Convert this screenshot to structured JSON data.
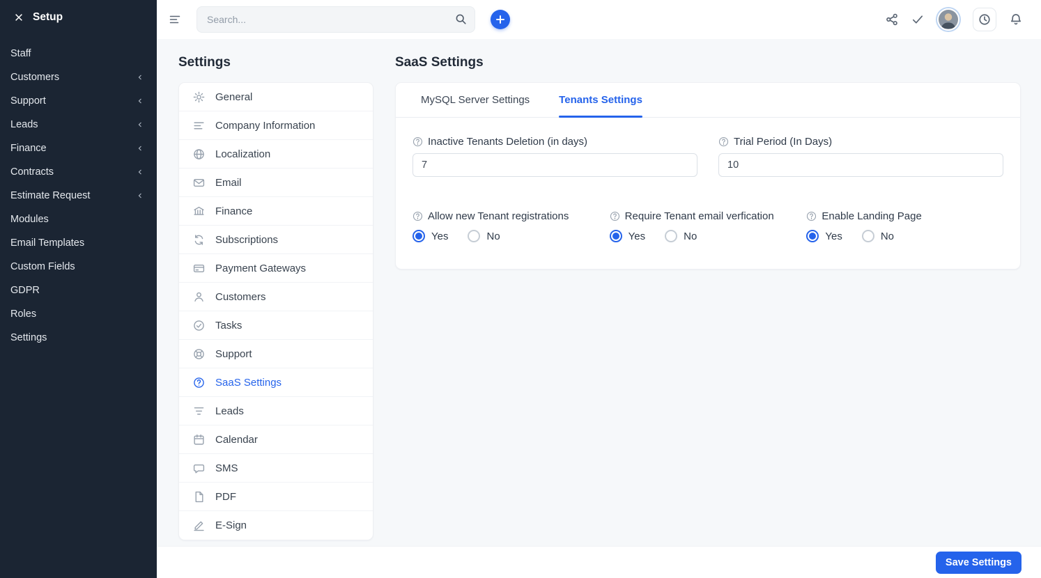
{
  "colors": {
    "accent": "#2563eb",
    "sidebar_bg": "#1b2533"
  },
  "sidebar": {
    "title": "Setup",
    "items": [
      {
        "label": "Staff",
        "expandable": false
      },
      {
        "label": "Customers",
        "expandable": true
      },
      {
        "label": "Support",
        "expandable": true
      },
      {
        "label": "Leads",
        "expandable": true
      },
      {
        "label": "Finance",
        "expandable": true
      },
      {
        "label": "Contracts",
        "expandable": true
      },
      {
        "label": "Estimate Request",
        "expandable": true
      },
      {
        "label": "Modules",
        "expandable": false
      },
      {
        "label": "Email Templates",
        "expandable": false
      },
      {
        "label": "Custom Fields",
        "expandable": false
      },
      {
        "label": "GDPR",
        "expandable": false
      },
      {
        "label": "Roles",
        "expandable": false
      },
      {
        "label": "Settings",
        "expandable": false
      }
    ]
  },
  "topbar": {
    "search_placeholder": "Search...",
    "icons": [
      "menu-toggle-icon",
      "search-icon",
      "add-icon",
      "share-icon",
      "check-icon",
      "avatar",
      "clock-icon",
      "bell-icon"
    ]
  },
  "settings_menu": {
    "title": "Settings",
    "items": [
      {
        "label": "General",
        "icon": "gear-icon"
      },
      {
        "label": "Company Information",
        "icon": "align-left-icon"
      },
      {
        "label": "Localization",
        "icon": "globe-icon"
      },
      {
        "label": "Email",
        "icon": "envelope-icon"
      },
      {
        "label": "Finance",
        "icon": "bank-icon"
      },
      {
        "label": "Subscriptions",
        "icon": "refresh-icon"
      },
      {
        "label": "Payment Gateways",
        "icon": "credit-card-icon"
      },
      {
        "label": "Customers",
        "icon": "user-icon"
      },
      {
        "label": "Tasks",
        "icon": "check-circle-icon"
      },
      {
        "label": "Support",
        "icon": "life-ring-icon"
      },
      {
        "label": "SaaS Settings",
        "icon": "question-circle-icon",
        "active": true
      },
      {
        "label": "Leads",
        "icon": "funnel-icon"
      },
      {
        "label": "Calendar",
        "icon": "calendar-icon"
      },
      {
        "label": "SMS",
        "icon": "chat-icon"
      },
      {
        "label": "PDF",
        "icon": "file-icon"
      },
      {
        "label": "E-Sign",
        "icon": "signature-icon"
      }
    ]
  },
  "saas": {
    "title": "SaaS Settings",
    "tabs": [
      {
        "label": "MySQL Server Settings",
        "active": false
      },
      {
        "label": "Tenants Settings",
        "active": true
      }
    ],
    "fields": [
      {
        "label": "Inactive Tenants Deletion (in days)",
        "value": "7"
      },
      {
        "label": "Trial Period (In Days)",
        "value": "10"
      }
    ],
    "radio_groups": [
      {
        "label": "Allow new Tenant registrations",
        "selected": "Yes",
        "options": [
          "Yes",
          "No"
        ]
      },
      {
        "label": "Require Tenant email verfication",
        "selected": "Yes",
        "options": [
          "Yes",
          "No"
        ]
      },
      {
        "label": "Enable Landing Page",
        "selected": "Yes",
        "options": [
          "Yes",
          "No"
        ]
      }
    ]
  },
  "footer": {
    "save_label": "Save Settings"
  }
}
